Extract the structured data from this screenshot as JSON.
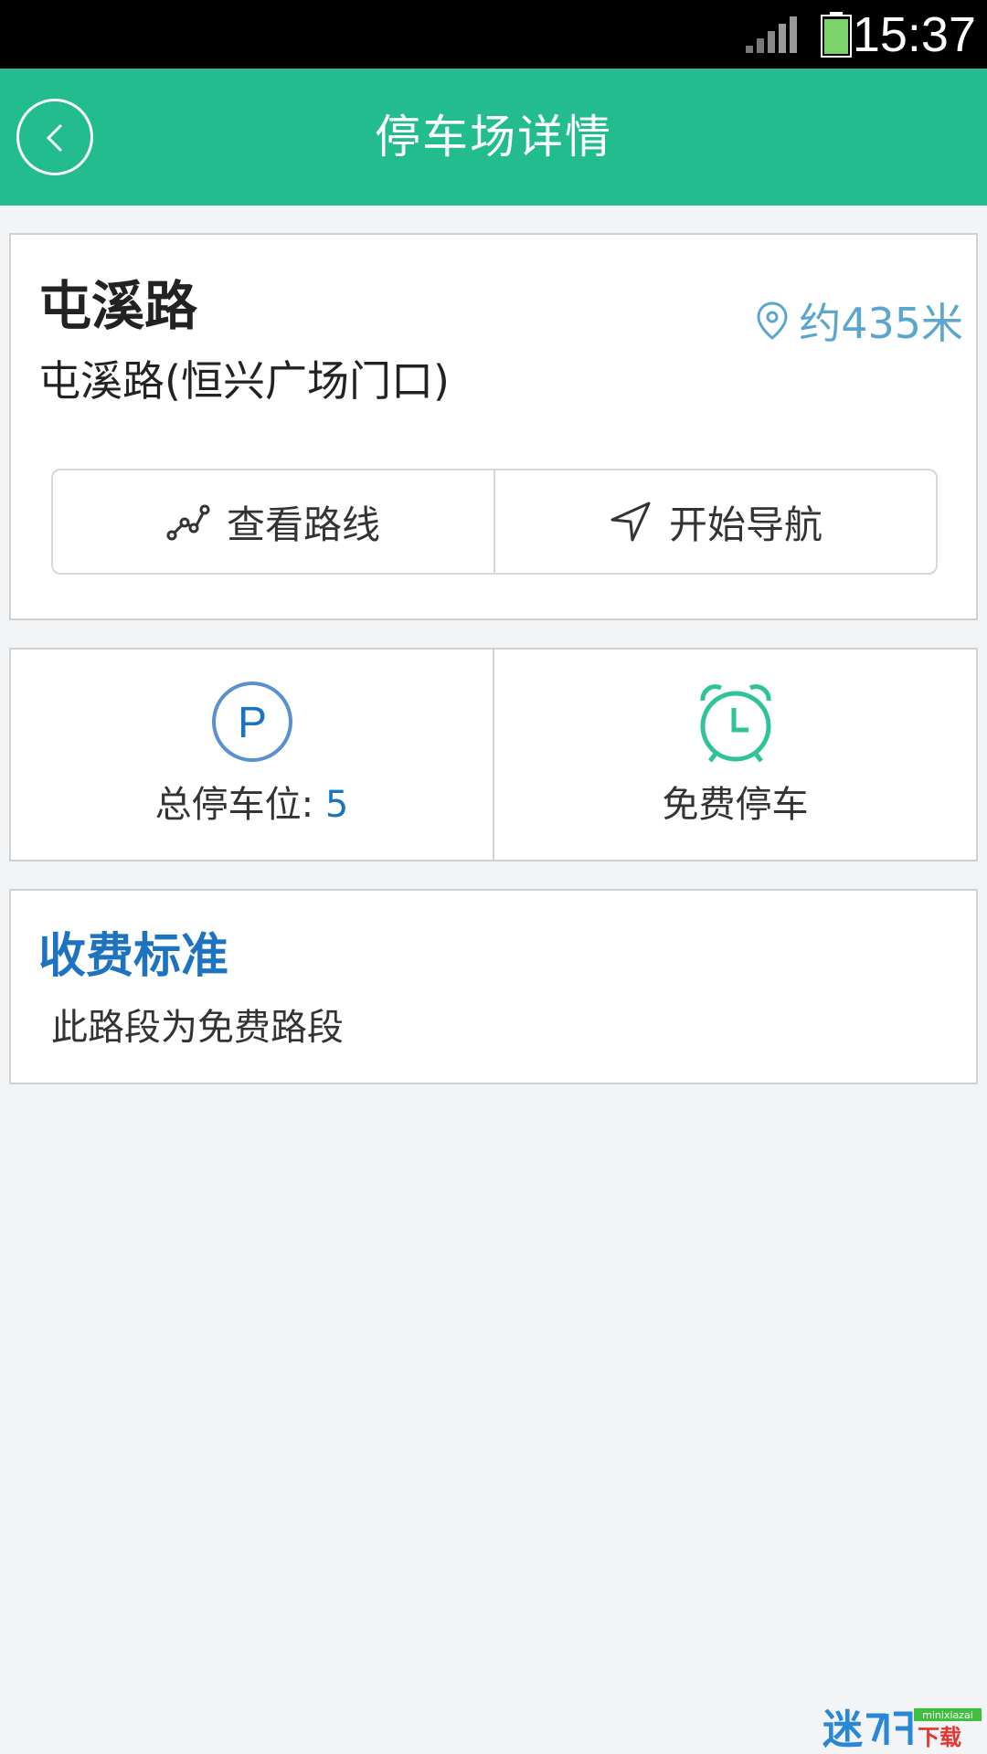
{
  "status_bar": {
    "time": "15:37",
    "battery_color": "#7bd36a"
  },
  "app_bar": {
    "title": "停车场详情",
    "background": "#22bc8e"
  },
  "parking_lot": {
    "name": "屯溪路",
    "address": "屯溪路(恒兴广场门口)",
    "distance": "约435米"
  },
  "actions": {
    "view_route": "查看路线",
    "start_navigation": "开始导航"
  },
  "stats": {
    "total_label": "总停车位: ",
    "total_value": "5",
    "parking_icon_letter": "P",
    "free_label": "免费停车"
  },
  "fee": {
    "title": "收费标准",
    "description": "此路段为免费路段"
  },
  "watermark": {
    "brand": "迷",
    "site": "minixiazai",
    "suffix": "下载"
  }
}
